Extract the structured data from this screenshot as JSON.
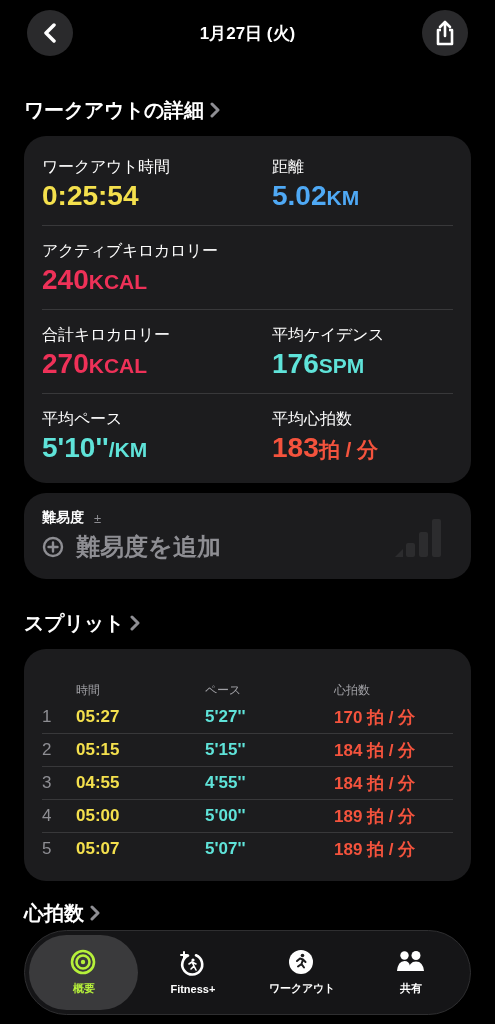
{
  "header": {
    "title": "1月27日 (火)"
  },
  "details": {
    "title": "ワークアウトの詳細",
    "metrics": [
      {
        "label": "ワークアウト時間",
        "value": "0:25:54",
        "color": "#f4e04d"
      },
      {
        "label": "距離",
        "value": "5.02",
        "unit": "KM",
        "color": "#4fa9f5"
      },
      {
        "label": "アクティブキロカロリー",
        "value": "240",
        "unit": "KCAL",
        "color": "#ee3158"
      },
      {
        "label": "合計キロカロリー",
        "value": "270",
        "unit": "KCAL",
        "color": "#ee3158"
      },
      {
        "label": "平均ケイデンス",
        "value": "176",
        "unit": "SPM",
        "color": "#5fe3d9"
      },
      {
        "label": "平均ペース",
        "value": "5'10''",
        "unit": "/KM",
        "color": "#5fe3d9"
      },
      {
        "label": "平均心拍数",
        "value": "183",
        "unit": "拍 / 分",
        "color": "#f4533d"
      }
    ]
  },
  "difficulty": {
    "label": "難易度",
    "hint": "±",
    "action": "難易度を追加"
  },
  "splits": {
    "title": "スプリット",
    "columns": [
      "時間",
      "ペース",
      "心拍数"
    ],
    "rows": [
      {
        "index": "1",
        "time": "05:27",
        "pace": "5'27''",
        "heart_rate": "170 拍 / 分"
      },
      {
        "index": "2",
        "time": "05:15",
        "pace": "5'15''",
        "heart_rate": "184 拍 / 分"
      },
      {
        "index": "3",
        "time": "04:55",
        "pace": "4'55''",
        "heart_rate": "184 拍 / 分"
      },
      {
        "index": "4",
        "time": "05:00",
        "pace": "5'00''",
        "heart_rate": "189 拍 / 分"
      },
      {
        "index": "5",
        "time": "05:07",
        "pace": "5'07''",
        "heart_rate": "189 拍 / 分"
      }
    ]
  },
  "heart_rate_section": {
    "title": "心拍数"
  },
  "tab_bar": [
    {
      "label": "概要",
      "kind": "summary",
      "selected": true
    },
    {
      "label": "Fitness+",
      "kind": "fitness",
      "selected": false
    },
    {
      "label": "ワークアウト",
      "kind": "workout",
      "selected": false
    },
    {
      "label": "共有",
      "kind": "sharing",
      "selected": false
    }
  ]
}
